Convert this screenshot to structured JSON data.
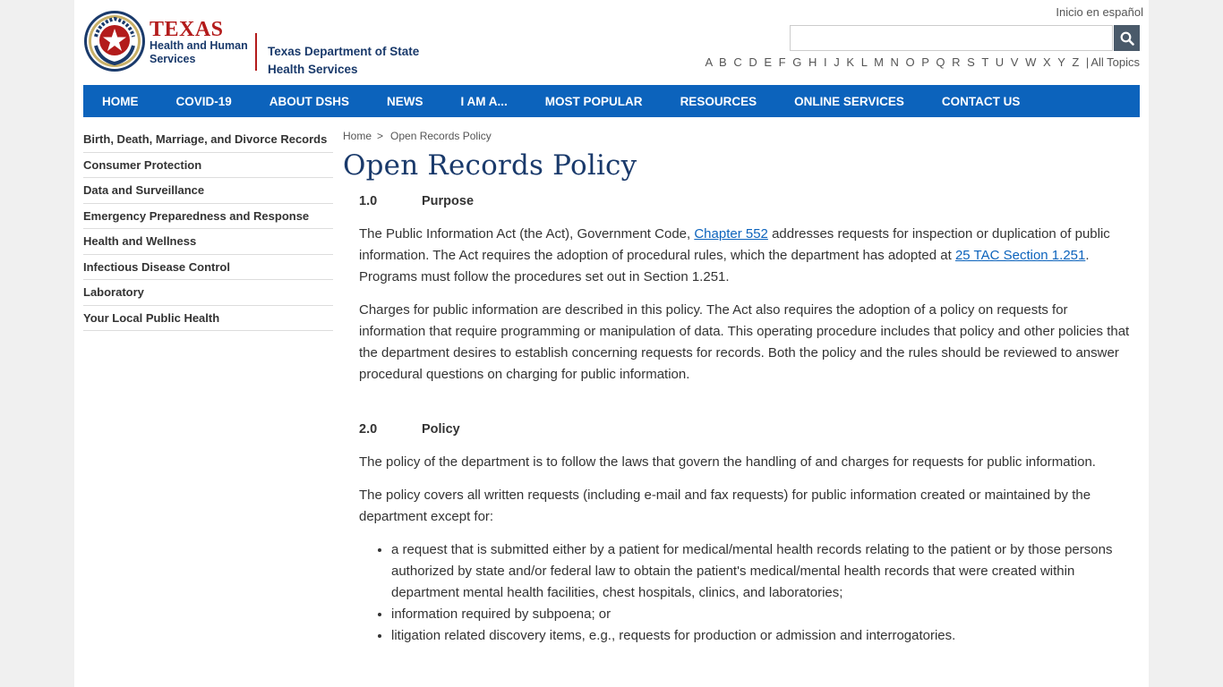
{
  "header": {
    "hhs_logo": {
      "line1": "TEXAS",
      "line2": "Health and Human",
      "line3": "Services"
    },
    "dshs_logo": {
      "line1": "Texas Department of State",
      "line2": "Health Services"
    },
    "espanol_link": "Inicio en español",
    "search": {
      "value": "",
      "placeholder": ""
    },
    "az_letters": [
      "A",
      "B",
      "C",
      "D",
      "E",
      "F",
      "G",
      "H",
      "I",
      "J",
      "K",
      "L",
      "M",
      "N",
      "O",
      "P",
      "Q",
      "R",
      "S",
      "T",
      "U",
      "V",
      "W",
      "X",
      "Y",
      "Z"
    ],
    "all_topics": "All Topics"
  },
  "nav": [
    "HOME",
    "COVID-19",
    "ABOUT DSHS",
    "NEWS",
    "I AM A...",
    "MOST POPULAR",
    "RESOURCES",
    "ONLINE SERVICES",
    "CONTACT US"
  ],
  "sidebar": [
    "Birth, Death, Marriage, and Divorce Records",
    "Consumer Protection",
    "Data and Surveillance",
    "Emergency Preparedness and Response",
    "Health and Wellness",
    "Infectious Disease Control",
    "Laboratory",
    "Your Local Public Health"
  ],
  "breadcrumb": {
    "home": "Home",
    "separator": ">",
    "current": "Open Records Policy"
  },
  "title": "Open Records Policy",
  "sections": [
    {
      "number": "1.0",
      "heading": "Purpose",
      "p1_a": "The Public Information Act (the Act), Government Code, ",
      "p1_link1": "Chapter 552",
      "p1_b": " addresses requests for inspection or duplication of public information. The Act requires the adoption of procedural rules, which the department has adopted at ",
      "p1_link2": "25 TAC Section 1.251",
      "p1_c": ". Programs must follow the procedures set out in Section 1.251.",
      "p2": "Charges for public information are described in this policy. The Act also requires the adoption of a policy on requests for information that require programming or manipulation of data. This operating procedure includes that policy and other policies that the department desires to establish concerning requests for records. Both the policy and the rules should be reviewed to answer procedural questions on charging for public information."
    },
    {
      "number": "2.0",
      "heading": "Policy",
      "p1": "The policy of the department is to follow the laws that govern the handling of and charges for requests for public information.",
      "p2": "The policy covers all written requests (including e-mail and fax requests) for public information created or maintained by the department except for:",
      "bullets": [
        "a request that is submitted either by a patient for medical/mental health records relating to the patient or by those persons authorized by state and/or federal law to obtain the patient's medical/mental health records that were created within department mental health facilities, chest hospitals, clinics, and laboratories;",
        "information required by subpoena; or",
        "litigation related discovery items, e.g., requests for production or admission and interrogatories."
      ]
    }
  ],
  "colors": {
    "nav_bg": "#0c63bc",
    "title": "#1a3a6b",
    "texas_red": "#b31b1b",
    "link": "#0c63bc"
  },
  "icons": {
    "search_button": "search-icon",
    "seal": "texas-seal-icon"
  }
}
